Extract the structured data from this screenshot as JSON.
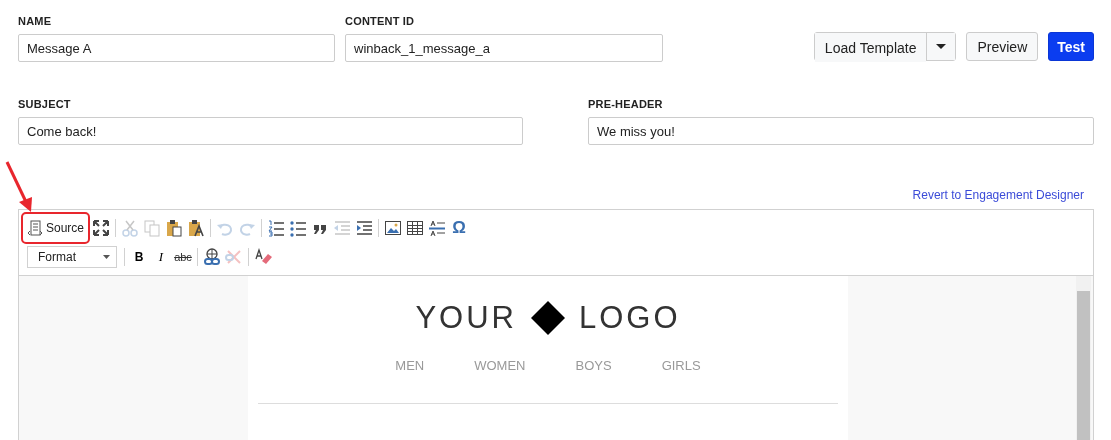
{
  "fields_row1": [
    {
      "label": "NAME",
      "value": "Message A"
    },
    {
      "label": "CONTENT ID",
      "value": "winback_1_message_a"
    }
  ],
  "actions": {
    "load_template": "Load Template",
    "preview": "Preview",
    "test": "Test"
  },
  "fields_row2": [
    {
      "label": "SUBJECT",
      "value": "Come back!"
    },
    {
      "label": "PRE-HEADER",
      "value": "We miss you!"
    }
  ],
  "revert_link": "Revert to Engagement Designer",
  "toolbar_row1": [
    {
      "kind": "source",
      "label": "Source",
      "highlighted": true,
      "disabled": false
    },
    {
      "kind": "maximize",
      "disabled": false
    },
    {
      "kind": "separator"
    },
    {
      "kind": "cut",
      "disabled": true
    },
    {
      "kind": "copy",
      "disabled": true
    },
    {
      "kind": "paste",
      "disabled": false
    },
    {
      "kind": "paste_text",
      "disabled": false
    },
    {
      "kind": "separator"
    },
    {
      "kind": "undo",
      "disabled": true
    },
    {
      "kind": "redo",
      "disabled": true
    },
    {
      "kind": "separator"
    },
    {
      "kind": "numbered_list",
      "disabled": false
    },
    {
      "kind": "bulleted_list",
      "disabled": false
    },
    {
      "kind": "blockquote",
      "disabled": false
    },
    {
      "kind": "outdent",
      "disabled": true
    },
    {
      "kind": "indent",
      "disabled": false
    },
    {
      "kind": "separator"
    },
    {
      "kind": "image",
      "disabled": false
    },
    {
      "kind": "table",
      "disabled": false
    },
    {
      "kind": "horizontal_rule",
      "disabled": false
    },
    {
      "kind": "special_char",
      "label": "Ω",
      "disabled": false
    }
  ],
  "toolbar_row2": [
    {
      "kind": "format",
      "label": "Format"
    },
    {
      "kind": "separator"
    },
    {
      "kind": "bold",
      "label": "B",
      "disabled": false
    },
    {
      "kind": "italic",
      "label": "I",
      "disabled": false
    },
    {
      "kind": "strike",
      "label": "abc",
      "disabled": false
    },
    {
      "kind": "separator"
    },
    {
      "kind": "link",
      "disabled": false
    },
    {
      "kind": "unlink",
      "disabled": true
    },
    {
      "kind": "separator"
    },
    {
      "kind": "remove_format",
      "disabled": false
    }
  ],
  "email": {
    "logo_left": "YOUR",
    "logo_right": "LOGO",
    "nav": [
      "MEN",
      "WOMEN",
      "BOYS",
      "GIRLS"
    ]
  }
}
